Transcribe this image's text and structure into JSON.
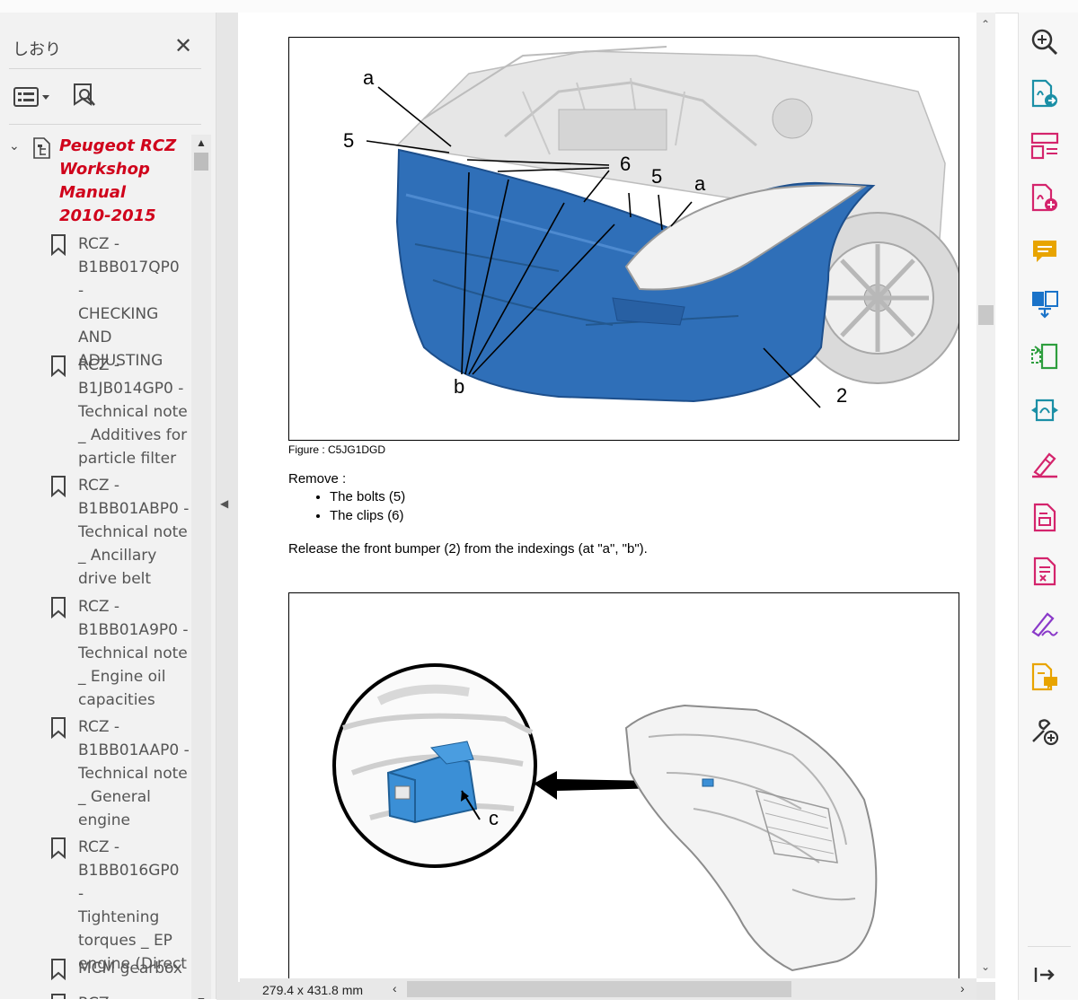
{
  "bookmarks_panel": {
    "title": "しおり",
    "close_glyph": "✕",
    "root": {
      "label": "Peugeot RCZ Workshop Manual 2010-2015",
      "lines": [
        "Peugeot RCZ",
        "Workshop",
        "Manual",
        "2010-2015"
      ],
      "expanded": true
    },
    "items": [
      {
        "lines": [
          "RCZ -",
          "B1BB017QP0 -",
          "CHECKING",
          "AND",
          "ADJUSTING"
        ]
      },
      {
        "lines": [
          "RCZ -",
          "B1JB014GP0 -",
          "Technical note",
          "_ Additives for",
          "particle filter"
        ]
      },
      {
        "lines": [
          "RCZ -",
          "B1BB01ABP0 -",
          "Technical note",
          "_ Ancillary",
          "drive belt"
        ]
      },
      {
        "lines": [
          "RCZ -",
          "B1BB01A9P0 -",
          "Technical note",
          "_ Engine oil",
          "capacities"
        ]
      },
      {
        "lines": [
          "RCZ -",
          "B1BB01AAP0 -",
          "Technical note",
          "_ General",
          "engine"
        ]
      },
      {
        "lines": [
          "RCZ -",
          "B1BB016GP0 -",
          "Tightening",
          "torques _ EP",
          "engine (Direct"
        ]
      },
      {
        "lines": [
          "MCM gearbox"
        ]
      },
      {
        "lines": [
          "RCZ -"
        ]
      }
    ]
  },
  "document": {
    "figure1": {
      "caption": "Figure : C5JG1DGD",
      "labels": {
        "a1": "a",
        "n5a": "5",
        "n6": "6",
        "n5b": "5",
        "a2": "a",
        "b": "b",
        "n2": "2"
      }
    },
    "remove_label": "Remove :",
    "steps": [
      "The bolts (5)",
      "The clips (6)"
    ],
    "release_text": "Release the front bumper (2) from the indexings (at \"a\", \"b\").",
    "figure2": {
      "labels": {
        "c": "c"
      }
    }
  },
  "status": {
    "page_size": "279.4 x 431.8 mm"
  },
  "colors": {
    "bumper_blue": "#2f6fb8",
    "root_red": "#d0021b",
    "tool_pink": "#d4246c",
    "tool_yellow": "#e8a400",
    "tool_blue": "#1a73c9",
    "tool_green": "#2e9e3e",
    "tool_teal": "#1b8fa6",
    "tool_purple": "#8a39c9"
  },
  "tools": [
    {
      "name": "enhance-scan-icon"
    },
    {
      "name": "export-pdf-icon"
    },
    {
      "name": "organize-pages-icon"
    },
    {
      "name": "create-pdf-icon"
    },
    {
      "name": "comment-icon"
    },
    {
      "name": "combine-files-icon"
    },
    {
      "name": "compress-pdf-icon"
    },
    {
      "name": "send-for-review-icon"
    },
    {
      "name": "fill-sign-icon"
    },
    {
      "name": "edit-pdf-icon"
    },
    {
      "name": "protect-pdf-icon"
    },
    {
      "name": "request-signature-icon"
    },
    {
      "name": "share-comment-icon"
    },
    {
      "name": "more-tools-icon"
    }
  ]
}
